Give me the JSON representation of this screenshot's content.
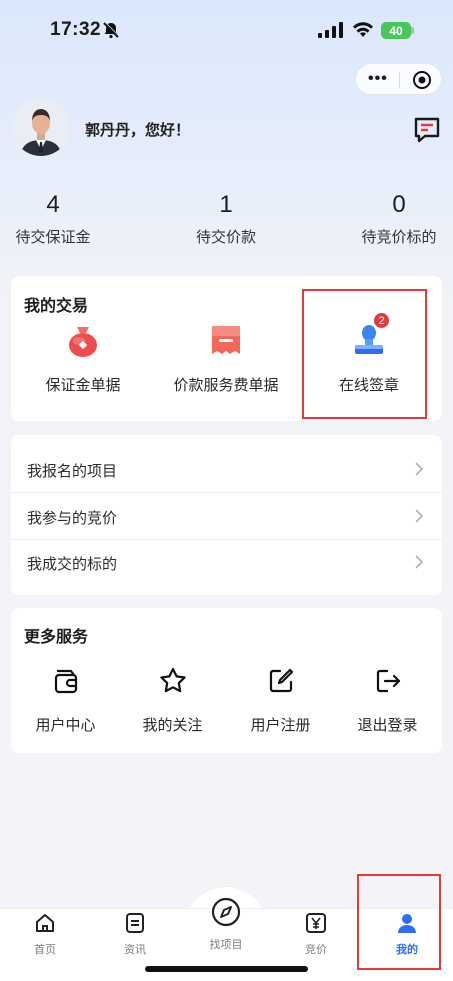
{
  "status_bar": {
    "time": "17:32",
    "battery": "40"
  },
  "profile": {
    "greeting": "郭丹丹，您好！"
  },
  "stats": [
    {
      "value": "4",
      "label": "待交保证金"
    },
    {
      "value": "1",
      "label": "待交价款"
    },
    {
      "value": "0",
      "label": "待竞价标的"
    }
  ],
  "trade": {
    "title": "我的交易",
    "items": [
      {
        "label": "保证金单据",
        "icon": "money-bag-icon"
      },
      {
        "label": "价款服务费单据",
        "icon": "receipt-icon"
      },
      {
        "label": "在线签章",
        "icon": "seal-stamp-icon",
        "badge": "2"
      }
    ]
  },
  "menu": [
    {
      "label": "我报名的项目"
    },
    {
      "label": "我参与的竞价"
    },
    {
      "label": "我成交的标的"
    }
  ],
  "services": {
    "title": "更多服务",
    "items": [
      {
        "label": "用户中心",
        "icon": "wallet-icon"
      },
      {
        "label": "我的关注",
        "icon": "star-icon"
      },
      {
        "label": "用户注册",
        "icon": "edit-icon"
      },
      {
        "label": "退出登录",
        "icon": "logout-icon"
      }
    ]
  },
  "tabbar": {
    "items": [
      {
        "label": "首页",
        "icon": "home-icon"
      },
      {
        "label": "资讯",
        "icon": "news-icon"
      },
      {
        "label": "找项目",
        "icon": "compass-icon"
      },
      {
        "label": "竞价",
        "icon": "yen-icon"
      },
      {
        "label": "我的",
        "icon": "user-icon",
        "active": true
      }
    ]
  },
  "colors": {
    "accent": "#2f6df6",
    "highlight_frame": "#e53935",
    "badge": "#e23b3b"
  }
}
